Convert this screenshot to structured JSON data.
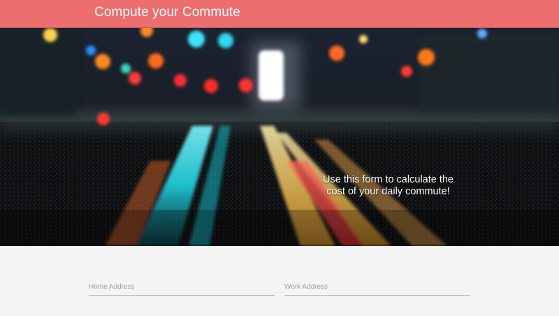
{
  "header": {
    "title": "Compute your Commute",
    "background": "#ec6e6e"
  },
  "hero": {
    "tagline": "Use this form to calculate the cost of your daily commute!"
  },
  "form": {
    "home_address": {
      "value": "",
      "placeholder": "Home Address"
    },
    "work_address": {
      "value": "",
      "placeholder": "Work Address"
    }
  }
}
